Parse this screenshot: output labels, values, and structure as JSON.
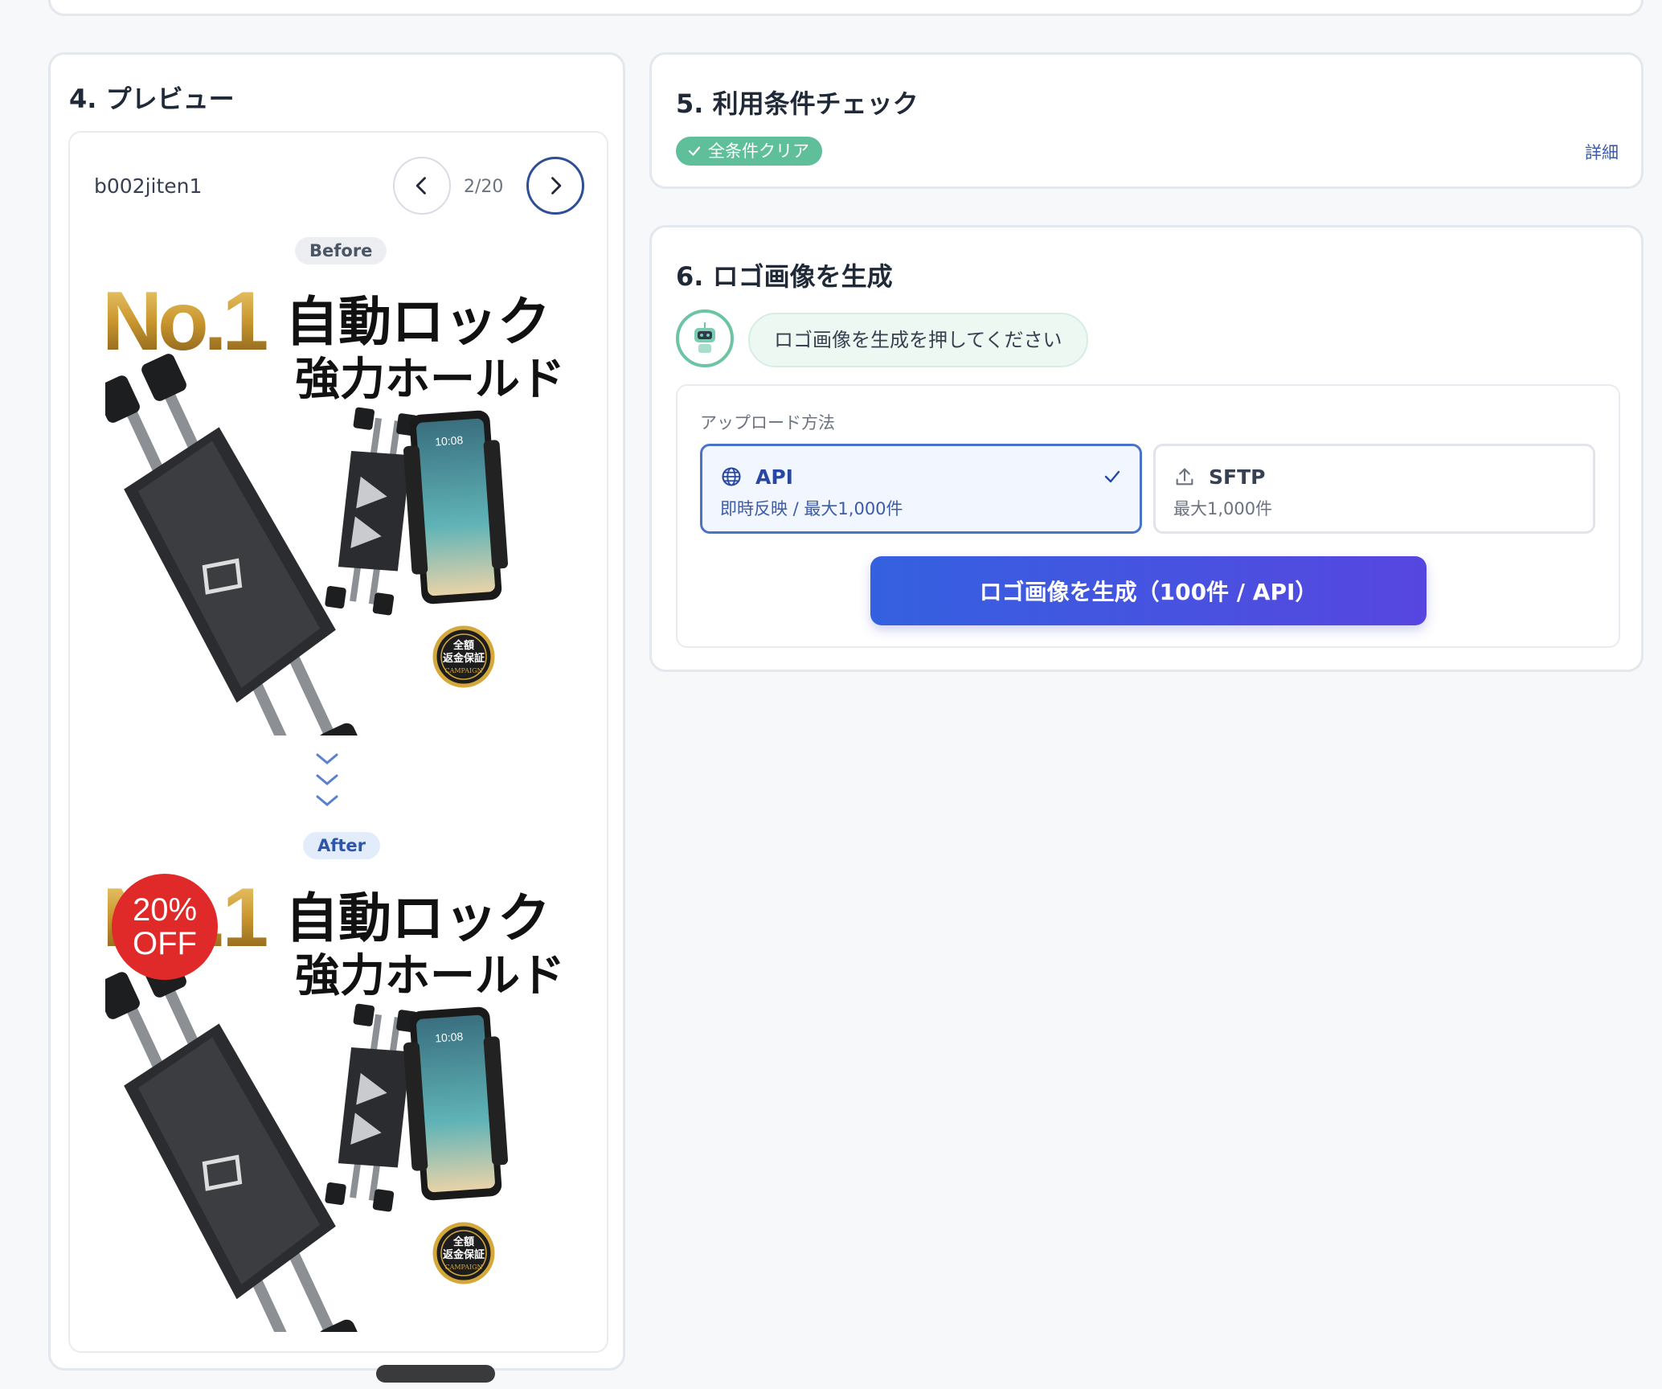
{
  "preview": {
    "title": "4. プレビュー",
    "item_id": "b002jiten1",
    "page_counter": "2/20",
    "before_label": "Before",
    "after_label": "After",
    "product_headline_no1": "No.1",
    "product_headline_main": "自動ロック",
    "product_headline_sub": "強力ホールド",
    "guarantee_seal_line1": "全額",
    "guarantee_seal_line2": "返金保証",
    "guarantee_seal_line3": "CAMPAIGN",
    "phone_time": "10:08",
    "sale_badge_line1": "20%",
    "sale_badge_line2": "OFF"
  },
  "terms": {
    "title": "5. 利用条件チェック",
    "status_badge": "全条件クリア",
    "details_link": "詳細"
  },
  "generate": {
    "title": "6. ロゴ画像を生成",
    "assistant_message": "ロゴ画像を生成を押してください",
    "upload_method_label": "アップロード方法",
    "options": [
      {
        "title": "API",
        "subtitle": "即時反映 / 最大1,000件",
        "selected": true
      },
      {
        "title": "SFTP",
        "subtitle": "最大1,000件",
        "selected": false
      }
    ],
    "button_label": "ロゴ画像を生成（100件 / API）"
  },
  "colors": {
    "accent": "#3461e0",
    "success": "#5fbf9a",
    "sale": "#e02a2a"
  }
}
